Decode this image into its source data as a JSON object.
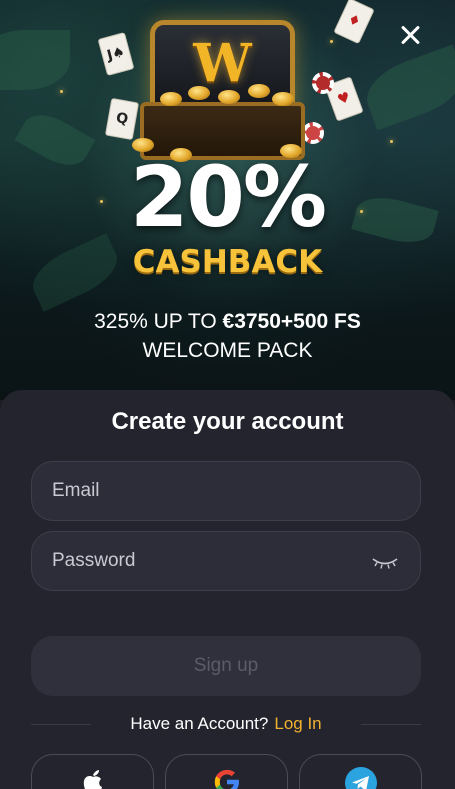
{
  "promo": {
    "percent": "20%",
    "cashback": "CASHBACK",
    "line1_prefix": "325% UP TO ",
    "line1_bold": "€3750+500 FS",
    "line2": "WELCOME PACK",
    "chest_letter": "W"
  },
  "form": {
    "title": "Create your account",
    "email_placeholder": "Email",
    "password_placeholder": "Password",
    "signup_label": "Sign up",
    "have_account": "Have an Account?",
    "login_label": "Log In"
  },
  "social": [
    {
      "icon": "apple-icon"
    },
    {
      "icon": "google-icon"
    },
    {
      "icon": "telegram-icon"
    }
  ],
  "colors": {
    "accent": "#f2b230",
    "sheet_bg": "#23242e",
    "field_bg": "#2c2d38",
    "cashback_gold": "#f6c33a"
  }
}
